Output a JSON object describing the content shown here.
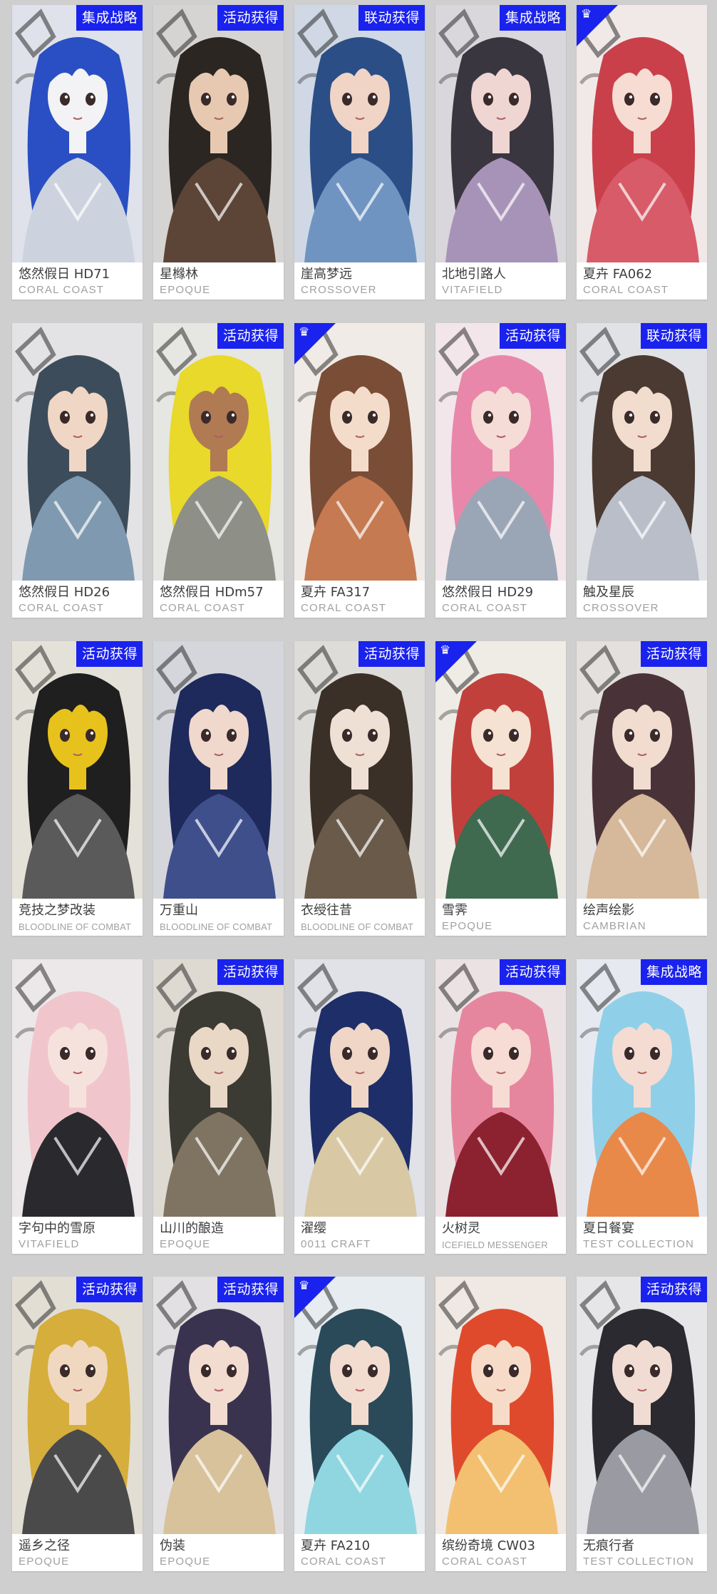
{
  "colors": {
    "page_background": "#cfcfcf",
    "card_background": "#ffffff",
    "badge_background": "#1a22ee",
    "name_text": "#3c3c3c",
    "brand_text": "#a0a0a0"
  },
  "corner_icon": "crown-badge-icon",
  "skins": [
    {
      "name": "悠然假日 HD71",
      "brand": "CORAL COAST",
      "badge": "集成战略",
      "corner": false,
      "palette": [
        "#dfe2ea",
        "#2a4fc4",
        "#f3f3f6",
        "#cdd3de"
      ]
    },
    {
      "name": "星橼林",
      "brand": "EPOQUE",
      "badge": "活动获得",
      "corner": false,
      "palette": [
        "#d6d4d2",
        "#2b2622",
        "#e7c9b2",
        "#5c4536"
      ]
    },
    {
      "name": "崖高梦远",
      "brand": "CROSSOVER",
      "badge": "联动获得",
      "corner": false,
      "palette": [
        "#cfd8e4",
        "#2c4e86",
        "#f0d4c6",
        "#6f94c2"
      ]
    },
    {
      "name": "北地引路人",
      "brand": "VITAFIELD",
      "badge": "集成战略",
      "corner": false,
      "palette": [
        "#d9d6dc",
        "#3a3640",
        "#efd6d2",
        "#a893b8"
      ]
    },
    {
      "name": "夏卉 FA062",
      "brand": "CORAL COAST",
      "badge": "",
      "corner": true,
      "palette": [
        "#f1e9e8",
        "#c9404a",
        "#f6dcd2",
        "#d75b69"
      ]
    },
    {
      "name": "悠然假日 HD26",
      "brand": "CORAL COAST",
      "badge": "",
      "corner": false,
      "palette": [
        "#e3e3e6",
        "#3c4c5a",
        "#f0d6c4",
        "#7f9ab0"
      ]
    },
    {
      "name": "悠然假日 HDm57",
      "brand": "CORAL COAST",
      "badge": "活动获得",
      "corner": false,
      "palette": [
        "#e6e6e2",
        "#e8d92a",
        "#b07a52",
        "#8e8f86"
      ]
    },
    {
      "name": "夏卉 FA317",
      "brand": "CORAL COAST",
      "badge": "",
      "corner": true,
      "palette": [
        "#f0ebe6",
        "#7a4d37",
        "#f4dccb",
        "#c57a52"
      ]
    },
    {
      "name": "悠然假日 HD29",
      "brand": "CORAL COAST",
      "badge": "活动获得",
      "corner": false,
      "palette": [
        "#f2e6ea",
        "#e887aa",
        "#f6dcd6",
        "#9aa6b6"
      ]
    },
    {
      "name": "触及星辰",
      "brand": "CROSSOVER",
      "badge": "联动获得",
      "corner": false,
      "palette": [
        "#e1e2e6",
        "#4a3a32",
        "#f2dccd",
        "#b9bec8"
      ]
    },
    {
      "name": "竞技之梦改装",
      "brand": "BLOODLINE OF COMBAT",
      "badge": "活动获得",
      "corner": false,
      "small": true,
      "palette": [
        "#e4e2d8",
        "#1f1f1f",
        "#e8c21c",
        "#5a5a5a"
      ]
    },
    {
      "name": "万重山",
      "brand": "BLOODLINE OF COMBAT",
      "badge": "",
      "corner": false,
      "small": true,
      "palette": [
        "#d4d6dc",
        "#1e2a5c",
        "#f0d8cc",
        "#3f4f8c"
      ]
    },
    {
      "name": "衣绶往昔",
      "brand": "BLOODLINE OF COMBAT",
      "badge": "活动获得",
      "corner": false,
      "small": true,
      "palette": [
        "#dedcd8",
        "#3b3028",
        "#eee0d4",
        "#6a5a4a"
      ]
    },
    {
      "name": "雪霁",
      "brand": "EPOQUE",
      "badge": "",
      "corner": true,
      "palette": [
        "#efece6",
        "#c2403c",
        "#f6e2d2",
        "#3f6a50"
      ]
    },
    {
      "name": "绘声绘影",
      "brand": "CAMBRIAN",
      "badge": "活动获得",
      "corner": false,
      "palette": [
        "#e3e0de",
        "#4a3338",
        "#f2dcd0",
        "#d6b89a"
      ]
    },
    {
      "name": "字句中的雪原",
      "brand": "VITAFIELD",
      "badge": "",
      "corner": false,
      "palette": [
        "#ece8ea",
        "#f0c6cc",
        "#f6e2dc",
        "#2a2a2e"
      ]
    },
    {
      "name": "山川的酿造",
      "brand": "EPOQUE",
      "badge": "活动获得",
      "corner": false,
      "palette": [
        "#dedad2",
        "#3b3a33",
        "#e9d8c6",
        "#7f7462"
      ]
    },
    {
      "name": "濯缨",
      "brand": "0011 CRAFT",
      "badge": "",
      "corner": false,
      "palette": [
        "#e0e2e8",
        "#1e2e68",
        "#efd6c6",
        "#d8c8a4"
      ]
    },
    {
      "name": "火树灵",
      "brand": "ICEFIELD MESSENGER",
      "badge": "活动获得",
      "corner": false,
      "small": true,
      "palette": [
        "#ebe2e4",
        "#e6869e",
        "#f6dcd4",
        "#8c2230"
      ]
    },
    {
      "name": "夏日餐宴",
      "brand": "TEST COLLECTION",
      "badge": "集成战略",
      "corner": false,
      "palette": [
        "#e6eaf0",
        "#8fd0e8",
        "#f4dcd2",
        "#e8894a"
      ]
    },
    {
      "name": "遥乡之径",
      "brand": "EPOQUE",
      "badge": "活动获得",
      "corner": false,
      "palette": [
        "#e2ded4",
        "#d6ae3c",
        "#f0d8c0",
        "#4a4a4a"
      ]
    },
    {
      "name": "伪装",
      "brand": "EPOQUE",
      "badge": "活动获得",
      "corner": false,
      "palette": [
        "#e2e0e2",
        "#3a3350",
        "#f2dcd0",
        "#d8c29c"
      ]
    },
    {
      "name": "夏卉 FA210",
      "brand": "CORAL COAST",
      "badge": "",
      "corner": true,
      "palette": [
        "#e6ecf0",
        "#2a4a5a",
        "#f2dcd0",
        "#8fd6e0"
      ]
    },
    {
      "name": "缤纷奇境 CW03",
      "brand": "CORAL COAST",
      "badge": "",
      "corner": false,
      "palette": [
        "#f0e8e2",
        "#e04a2c",
        "#f6dcc8",
        "#f2c070"
      ]
    },
    {
      "name": "无痕行者",
      "brand": "TEST COLLECTION",
      "badge": "活动获得",
      "corner": false,
      "palette": [
        "#e6e6e8",
        "#2a2a30",
        "#f0dcd2",
        "#9a9aa2"
      ]
    }
  ]
}
